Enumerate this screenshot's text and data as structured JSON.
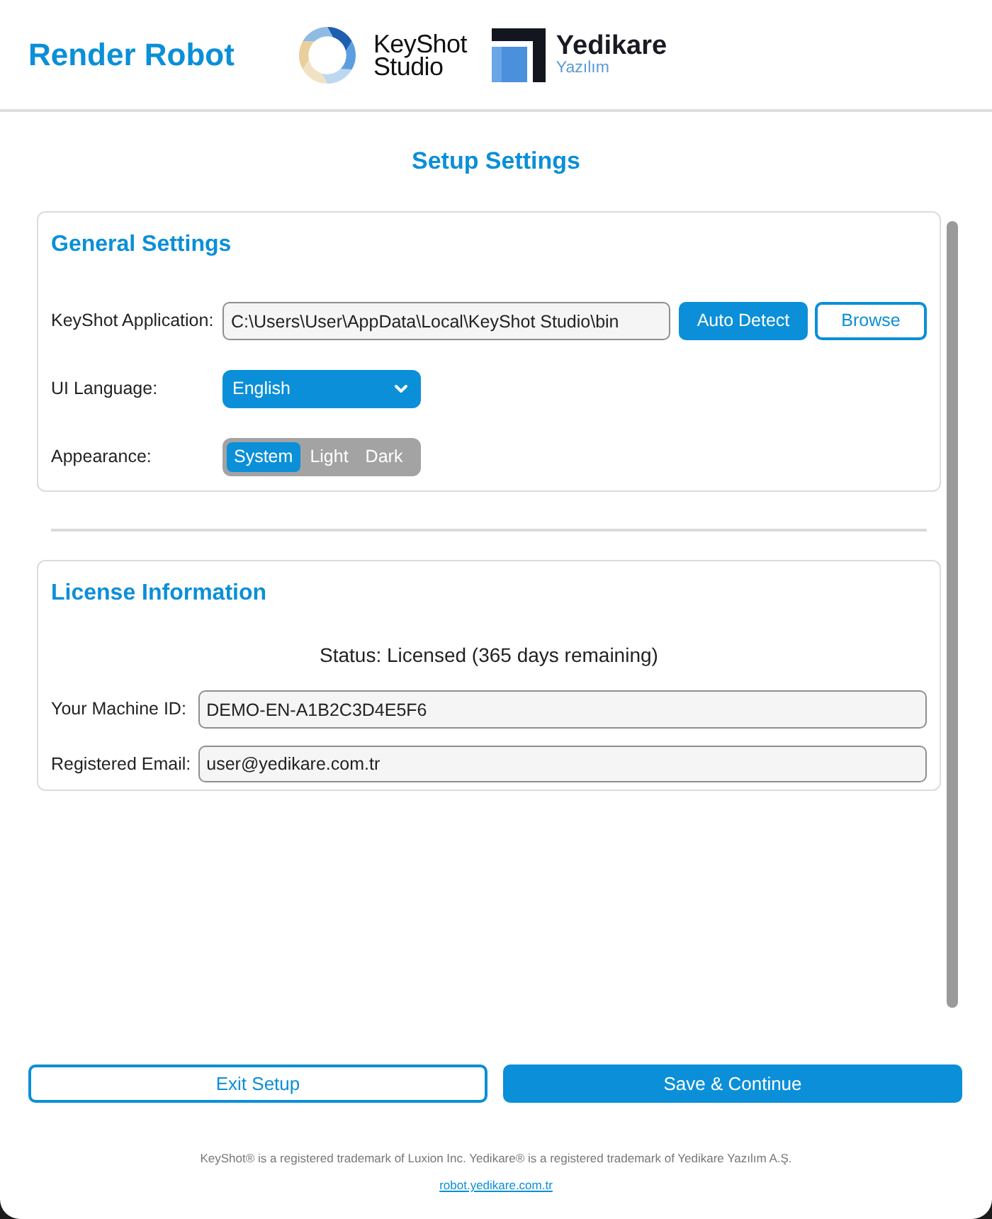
{
  "header": {
    "title": "Render Robot",
    "logos": [
      {
        "kind": "keyshot",
        "lines": [
          "KeyShot",
          "Studio"
        ]
      },
      {
        "kind": "yedikare",
        "name": "Yedikare",
        "subtitle": "Yazılım"
      }
    ]
  },
  "page_title": "Setup Settings",
  "general": {
    "title": "General Settings",
    "keyshot_path": {
      "label": "KeyShot Application:",
      "value": "C:\\Users\\User\\AppData\\Local\\KeyShot Studio\\bin",
      "buttons": [
        {
          "label": "Auto Detect",
          "kind": "primary"
        },
        {
          "label": "Browse",
          "kind": "outline"
        }
      ]
    },
    "language": {
      "label": "UI Language:",
      "value": "English"
    },
    "appearance": {
      "label": "Appearance:",
      "options": [
        {
          "label": "System",
          "selected": true
        },
        {
          "label": "Light",
          "selected": false
        },
        {
          "label": "Dark",
          "selected": false
        }
      ]
    }
  },
  "license": {
    "title": "License Information",
    "status": "Status: Licensed (365 days remaining)",
    "fields": [
      {
        "label": "Your Machine ID:",
        "value": "DEMO-EN-A1B2C3D4E5F6"
      },
      {
        "label": "Registered Email:",
        "value": "user@yedikare.com.tr"
      }
    ]
  },
  "actions": [
    {
      "label": "Exit Setup",
      "kind": "outline"
    },
    {
      "label": "Save & Continue",
      "kind": "primary"
    }
  ],
  "footer": {
    "notice": "KeyShot® is a registered trademark of Luxion Inc. Yedikare® is a registered trademark of Yedikare Yazılım A.Ş.",
    "link": "robot.yedikare.com.tr"
  }
}
